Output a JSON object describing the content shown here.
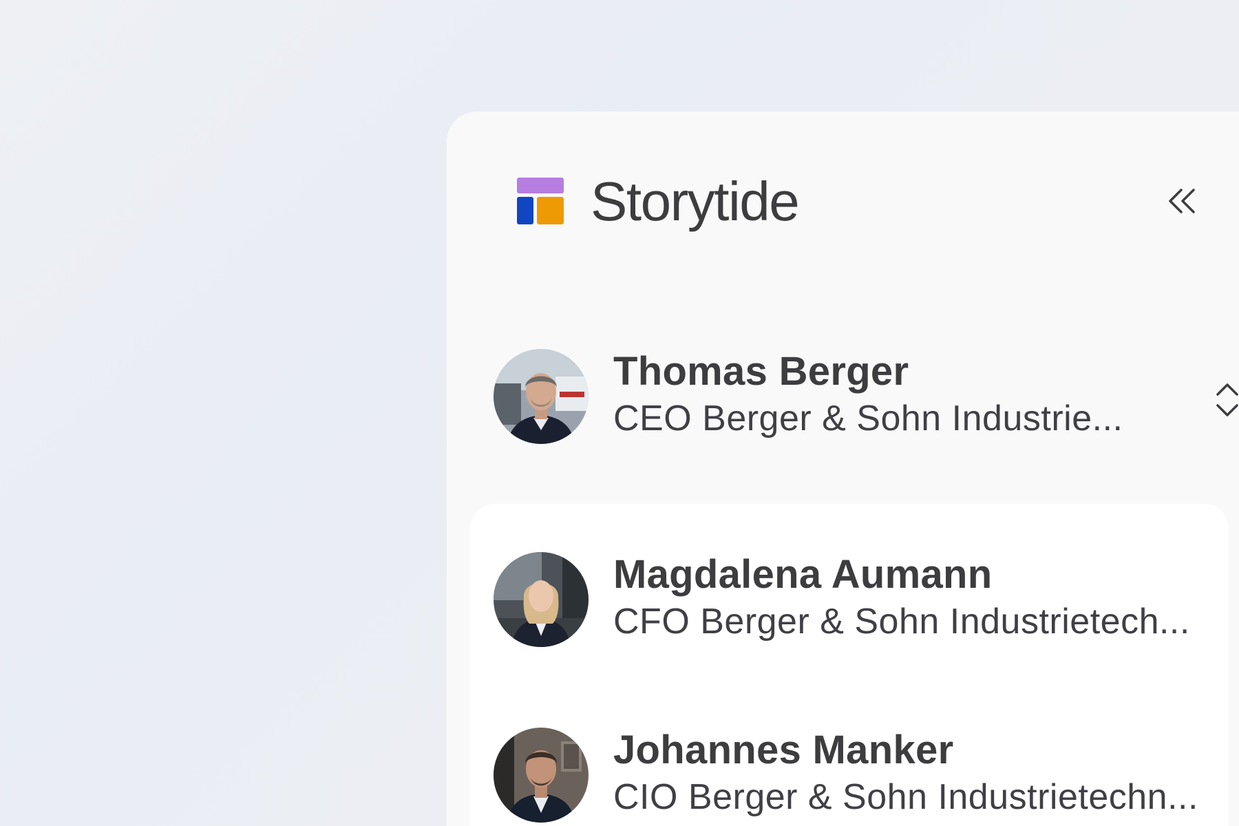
{
  "app": {
    "brand_name": "Storytide",
    "logo_colors": {
      "top": "#b57ee0",
      "bottom_left": "#1146c2",
      "bottom_right": "#ee9a05"
    },
    "collapse_icon": "chevrons-left-icon"
  },
  "current_account": {
    "name": "Thomas Berger",
    "role": "CEO Berger & Sohn Industrie...",
    "switch_icon": "chevrons-up-down-icon"
  },
  "accounts": [
    {
      "name": "Magdalena Aumann",
      "role": "CFO Berger & Sohn Industrietech..."
    },
    {
      "name": "Johannes Manker",
      "role": "CIO Berger & Sohn Industrietechn..."
    }
  ],
  "colors": {
    "text_primary": "#3d3d3f",
    "panel_bg": "#f9f9fa",
    "card_bg": "#ffffff"
  }
}
